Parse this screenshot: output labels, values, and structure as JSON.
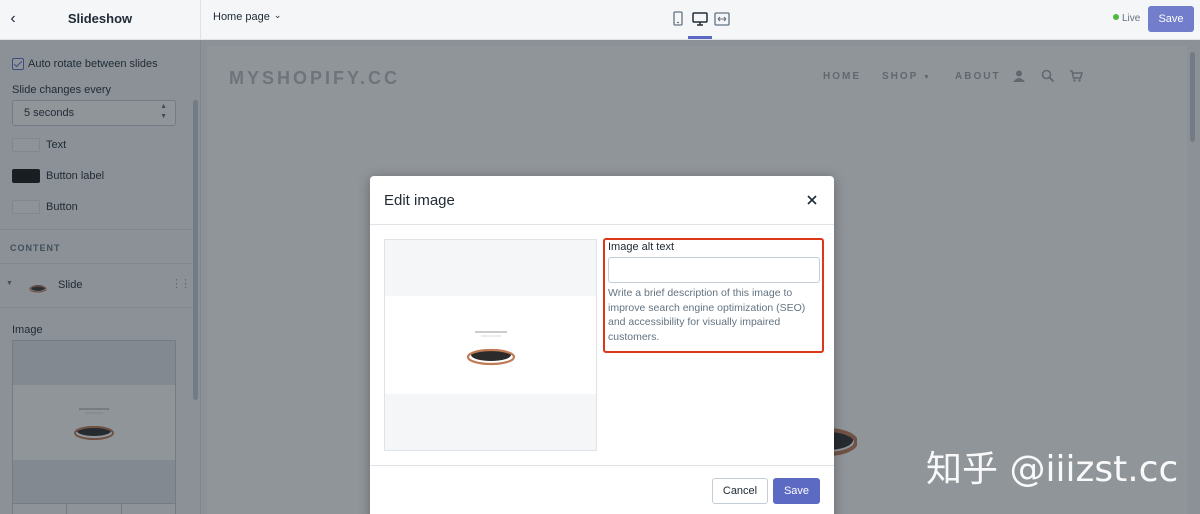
{
  "topbar": {
    "section_title": "Slideshow",
    "page_select": "Home page",
    "status": "Live",
    "save_label": "Save"
  },
  "sidebar": {
    "auto_rotate_label": "Auto rotate between slides",
    "slide_changes_label": "Slide changes every",
    "slide_interval_value": "5 seconds",
    "colors": [
      {
        "label": "Text",
        "color": "#fafbfc"
      },
      {
        "label": "Button label",
        "color": "#111111"
      },
      {
        "label": "Button",
        "color": "#fafbfc"
      }
    ],
    "content_heading": "CONTENT",
    "slide_label": "Slide",
    "image_label": "Image"
  },
  "preview": {
    "logo": "MYSHOPIFY.CC",
    "nav": [
      "HOME",
      "SHOP",
      "ABOUT"
    ],
    "icons": [
      "user-icon",
      "search-icon",
      "cart-icon"
    ]
  },
  "modal": {
    "title": "Edit image",
    "alt_label": "Image alt text",
    "alt_value": "",
    "help_text": "Write a brief description of this image to improve search engine optimization (SEO) and accessibility for visually impaired customers.",
    "cancel_label": "Cancel",
    "save_label": "Save",
    "highlight_color": "#de3618"
  },
  "watermark": "知乎 @iiizst.cc",
  "colors": {
    "accent": "#5c6ac4",
    "live": "#50b83c"
  }
}
